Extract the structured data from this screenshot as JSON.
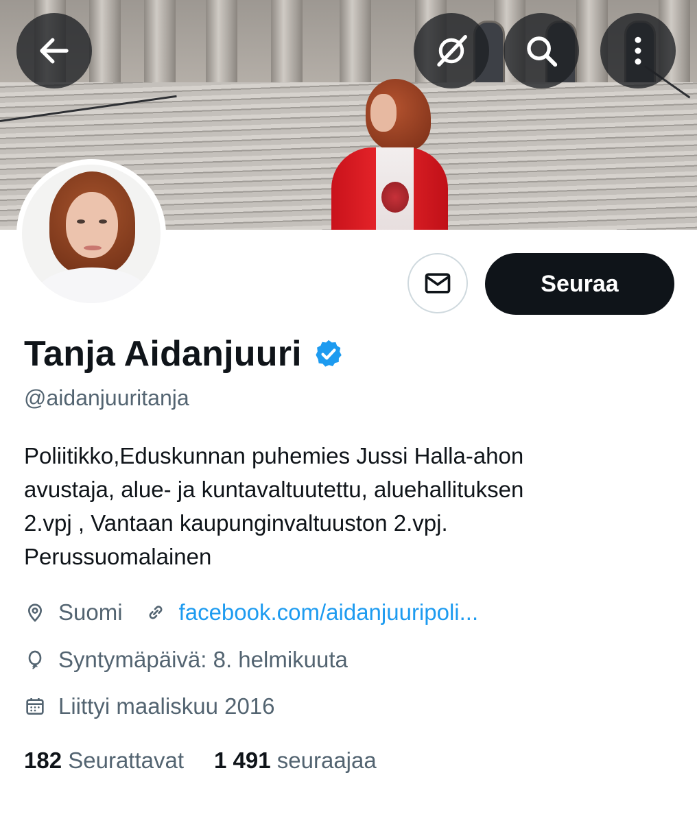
{
  "header": {
    "back_icon": "arrow-left-icon",
    "grok_icon": "grok-icon",
    "search_icon": "search-icon",
    "more_icon": "more-vertical-icon"
  },
  "profile": {
    "name": "Tanja Aidanjuuri",
    "handle": "@aidanjuuritanja",
    "bio_lines": [
      "Poliitikko,Eduskunnan puhemies Jussi Halla-ahon",
      "avustaja, alue- ja kuntavaltuutettu, aluehallituksen",
      "2.vpj , Vantaan kaupunginvaltuuston 2.vpj.",
      "Perussuomalainen"
    ],
    "location": "Suomi",
    "website": "facebook.com/aidanjuuripoli...",
    "birthday": "Syntymäpäivä: 8. helmikuuta",
    "joined": "Liittyi maaliskuu 2016",
    "following_count": "182",
    "following_label": "Seurattavat",
    "followers_count": "1 491",
    "followers_label": "seuraajaa"
  },
  "actions": {
    "follow_label": "Seuraa",
    "message_icon": "envelope-icon"
  },
  "colors": {
    "link": "#1d9bf0",
    "verified": "#1d9bf0",
    "follow_bg": "#0f1419",
    "secondary_text": "#536471"
  }
}
